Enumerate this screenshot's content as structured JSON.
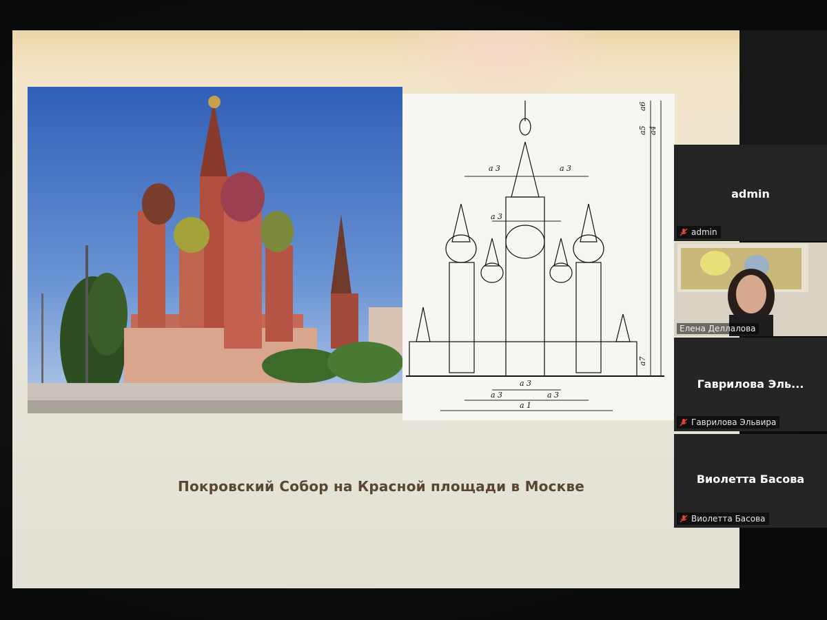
{
  "slide": {
    "caption": "Покровский Собор на Красной площади в Москве",
    "drawing_labels": {
      "a1": "a 1",
      "a3_top_left": "a 3",
      "a3_top_right": "a 3",
      "a3_mid": "a 3",
      "a3_bottom_center": "a 3",
      "a3_bottom_left": "a 3",
      "a3_bottom_right": "a 3",
      "a4": "a4",
      "a5": "a5",
      "a6": "a6",
      "a7": "a7"
    }
  },
  "participants": [
    {
      "display": "admin",
      "tag": "admin",
      "muted": true
    },
    {
      "display": "",
      "tag": "Елена Деллалова",
      "muted": false,
      "video": true
    },
    {
      "display": "Гаврилова Эль...",
      "tag": "Гаврилова Эльвира",
      "muted": true
    },
    {
      "display": "Виолетта Басова",
      "tag": "Виолетта Басова",
      "muted": true
    }
  ],
  "colors": {
    "caption": "#5a4632",
    "mute_icon": "#d9463b",
    "tile_bg": "#252525"
  },
  "icons": {
    "muted": "microphone-muted-icon"
  }
}
